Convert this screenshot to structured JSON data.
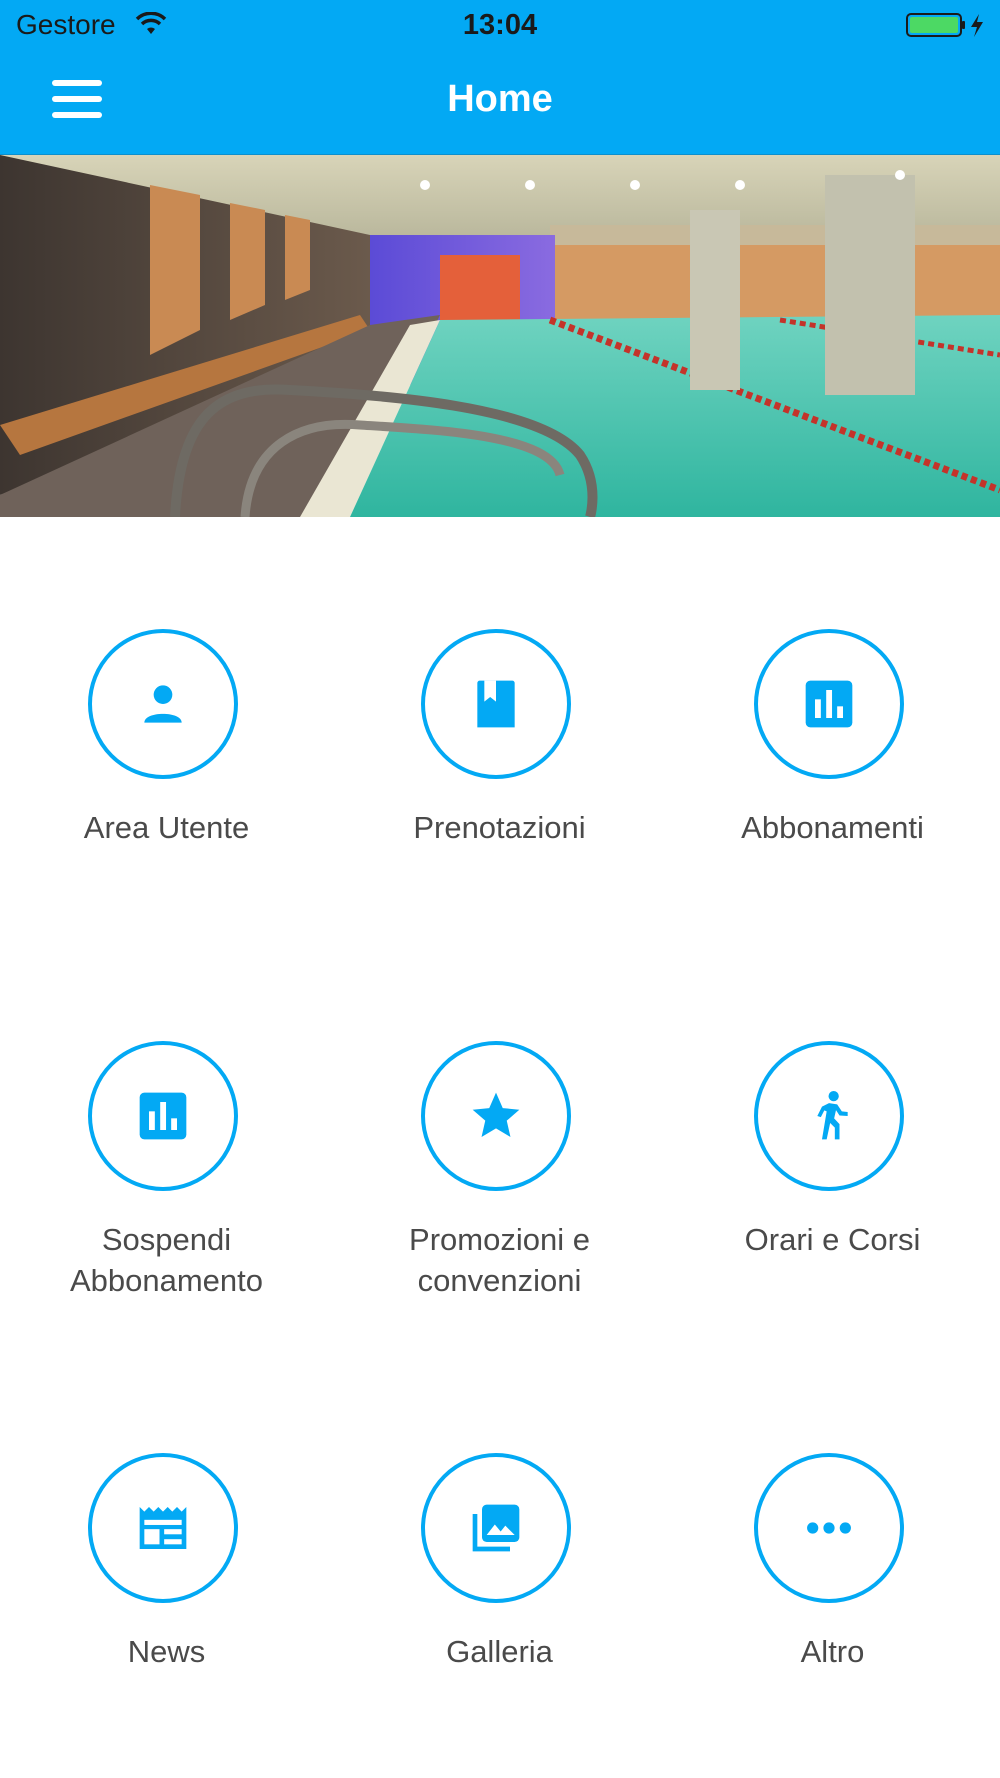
{
  "status_bar": {
    "carrier": "Gestore",
    "time": "13:04",
    "wifi_icon": "wifi-icon",
    "battery_icon": "battery-charging-icon",
    "battery_color": "#4cd964"
  },
  "nav": {
    "title": "Home",
    "menu_icon": "hamburger-menu-icon",
    "background": "#03a9f4"
  },
  "hero": {
    "image": "indoor swimming pool photo"
  },
  "accent_color": "#03a9f4",
  "tiles": [
    {
      "label": "Area Utente",
      "icon": "person-icon"
    },
    {
      "label": "Prenotazioni",
      "icon": "bookmark-book-icon"
    },
    {
      "label": "Abbonamenti",
      "icon": "bar-chart-icon"
    },
    {
      "label": "Sospendi Abbonamento",
      "icon": "bar-chart-icon"
    },
    {
      "label": "Promozioni e convenzioni",
      "icon": "star-icon"
    },
    {
      "label": "Orari e Corsi",
      "icon": "walking-person-icon"
    },
    {
      "label": "News",
      "icon": "newspaper-icon"
    },
    {
      "label": "Galleria",
      "icon": "photo-library-icon"
    },
    {
      "label": "Altro",
      "icon": "more-horizontal-icon"
    }
  ]
}
